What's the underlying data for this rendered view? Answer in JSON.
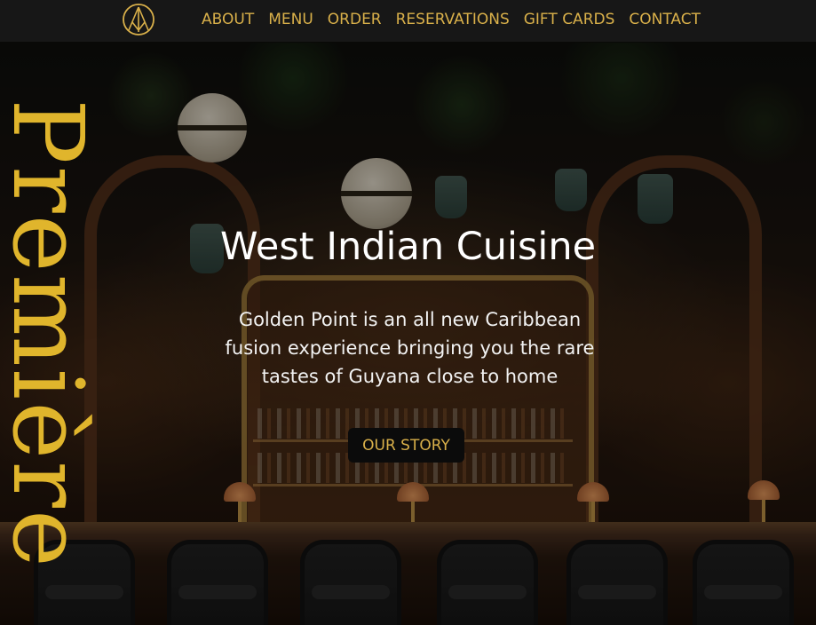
{
  "brand": {
    "vertical_text": "Première",
    "logo_icon": "compass-arrow-logo-icon",
    "accent_color": "#e0b52c"
  },
  "nav": {
    "items": [
      {
        "label": "ABOUT"
      },
      {
        "label": "MENU"
      },
      {
        "label": "ORDER"
      },
      {
        "label": "RESERVATIONS"
      },
      {
        "label": "GIFT CARDS"
      },
      {
        "label": "CONTACT"
      }
    ]
  },
  "hero": {
    "title": "West Indian Cuisine",
    "description": "Golden Point is an all new Caribbean fusion experience bringing you the rare tastes of Guyana close to home",
    "cta_label": "OUR STORY"
  },
  "colors": {
    "header_bg": "#171717",
    "nav_text": "#d9b04a",
    "cta_bg": "#0b0b0b"
  }
}
